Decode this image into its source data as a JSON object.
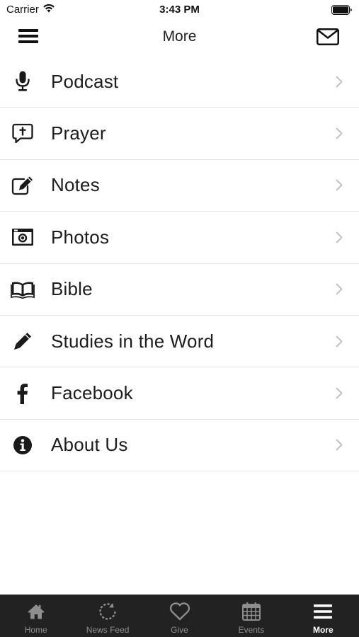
{
  "status_bar": {
    "carrier": "Carrier",
    "time": "3:43 PM"
  },
  "nav": {
    "title": "More"
  },
  "menu": {
    "items": [
      {
        "label": "Podcast",
        "icon": "microphone-icon"
      },
      {
        "label": "Prayer",
        "icon": "prayer-bubble-icon"
      },
      {
        "label": "Notes",
        "icon": "edit-note-icon"
      },
      {
        "label": "Photos",
        "icon": "camera-icon"
      },
      {
        "label": "Bible",
        "icon": "open-book-icon"
      },
      {
        "label": "Studies in the Word",
        "icon": "pencil-icon"
      },
      {
        "label": "Facebook",
        "icon": "facebook-icon"
      },
      {
        "label": "About Us",
        "icon": "info-icon"
      }
    ]
  },
  "tab_bar": {
    "tabs": [
      {
        "label": "Home",
        "icon": "home-icon",
        "active": false
      },
      {
        "label": "News Feed",
        "icon": "refresh-icon",
        "active": false
      },
      {
        "label": "Give",
        "icon": "heart-icon",
        "active": false
      },
      {
        "label": "Events",
        "icon": "calendar-icon",
        "active": false
      },
      {
        "label": "More",
        "icon": "hamburger-icon",
        "active": true
      }
    ]
  },
  "colors": {
    "tab_bar_bg": "#222222",
    "tab_inactive": "#8e8e8e",
    "tab_active": "#ffffff",
    "separator": "#e6e6e6",
    "chevron": "#c2c2c2"
  }
}
